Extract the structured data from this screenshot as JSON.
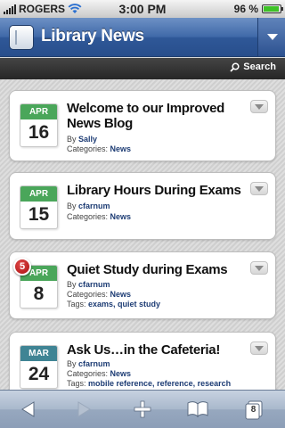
{
  "status_bar": {
    "carrier": "ROGERS",
    "time": "3:00 PM",
    "battery_percent_label": "96 %",
    "battery_level": 0.96
  },
  "header": {
    "title": "Library News"
  },
  "search": {
    "label": "Search"
  },
  "labels": {
    "by": "By",
    "categories": "Categories:",
    "tags": "Tags:"
  },
  "posts": [
    {
      "month": "APR",
      "day": "16",
      "month_color": "#4aa65a",
      "title": "Welcome to our Improved News Blog",
      "author": "Sally",
      "categories": "News",
      "tags": ""
    },
    {
      "month": "APR",
      "day": "15",
      "month_color": "#4aa65a",
      "title": "Library Hours During Exams",
      "author": "cfarnum",
      "categories": "News",
      "tags": ""
    },
    {
      "month": "APR",
      "day": "8",
      "month_color": "#4aa65a",
      "comment_count": "5",
      "title": "Quiet Study during Exams",
      "author": "cfarnum",
      "categories": "News",
      "tags": "exams, quiet study"
    },
    {
      "month": "MAR",
      "day": "24",
      "month_color": "#3f8494",
      "title": "Ask Us…in the Cafeteria!",
      "author": "cfarnum",
      "categories": "News",
      "tags": "mobile reference, reference, research"
    }
  ],
  "toolbar": {
    "open_pages_count": "8",
    "icons": [
      "back-arrow-icon",
      "forward-arrow-icon",
      "add-icon",
      "bookmarks-icon",
      "pages-icon"
    ]
  }
}
